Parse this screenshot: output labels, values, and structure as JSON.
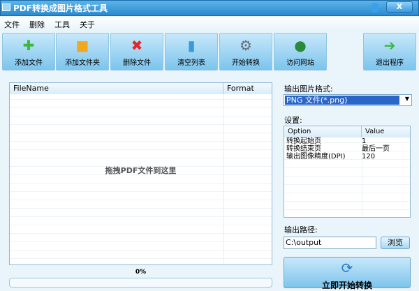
{
  "window": {
    "title": "PDF转换成图片格式工具",
    "close_label": "X"
  },
  "menu": [
    "文件",
    "删除",
    "工具",
    "关于"
  ],
  "toolbar": [
    {
      "label": "添加文件",
      "icon": "plus-icon",
      "glyph": "✚",
      "color": "#3cb83c"
    },
    {
      "label": "添加文件夹",
      "icon": "folder-icon",
      "glyph": "■",
      "color": "#f0a820"
    },
    {
      "label": "删除文件",
      "icon": "x-icon",
      "glyph": "✖",
      "color": "#e02828"
    },
    {
      "label": "清空列表",
      "icon": "bin-icon",
      "glyph": "▮",
      "color": "#3a9ad8"
    },
    {
      "label": "开始转换",
      "icon": "gears-icon",
      "glyph": "⚙",
      "color": "#607080"
    },
    {
      "label": "访问网站",
      "icon": "globe-icon",
      "glyph": "●",
      "color": "#2a8a3a"
    },
    {
      "label": "退出程序",
      "icon": "arrow-right-icon",
      "glyph": "➔",
      "color": "#3cb83c"
    }
  ],
  "file_list": {
    "columns": [
      "FileName",
      "Format"
    ],
    "drop_hint": "拖拽PDF文件到这里"
  },
  "progress": "0%",
  "format": {
    "label": "输出图片格式:",
    "value": "PNG 文件(*.png)"
  },
  "settings": {
    "label": "设置:",
    "columns": [
      "Option",
      "Value"
    ],
    "rows": [
      [
        "转换起始页",
        "1"
      ],
      [
        "转换结束页",
        "最后一页"
      ],
      [
        "输出图像精度(DPI)",
        "120"
      ]
    ]
  },
  "output": {
    "label": "输出路径:",
    "value": "C:\\output",
    "browse": "浏览"
  },
  "start_button": "立即开始转换"
}
